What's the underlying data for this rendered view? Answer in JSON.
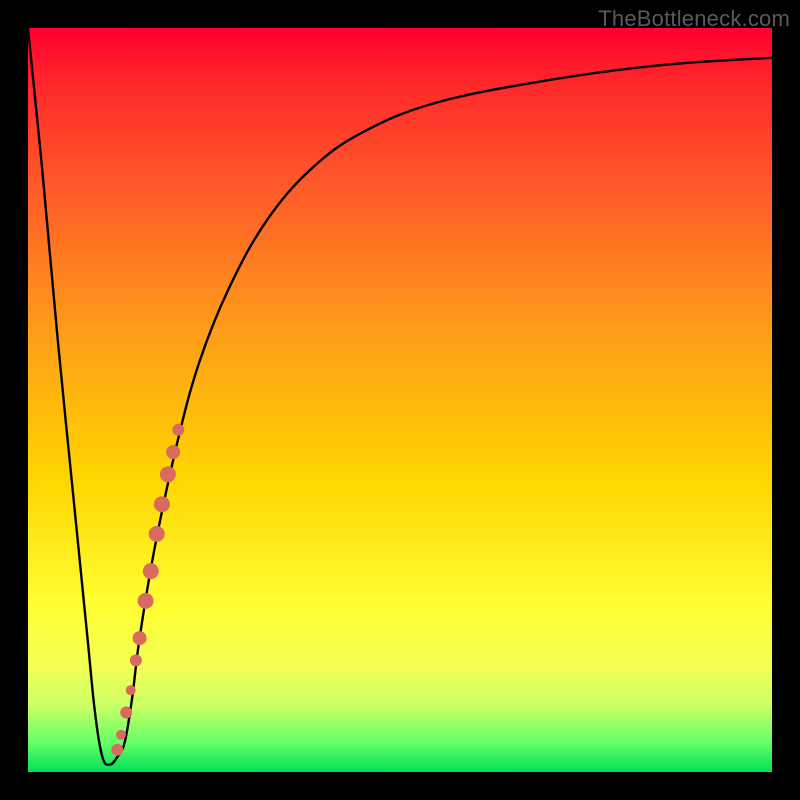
{
  "watermark": "TheBottleneck.com",
  "chart_data": {
    "type": "line",
    "title": "",
    "xlabel": "",
    "ylabel": "",
    "xlim": [
      0,
      100
    ],
    "ylim": [
      0,
      100
    ],
    "grid": false,
    "legend": false,
    "series": [
      {
        "name": "bottleneck-curve",
        "x": [
          0,
          2,
          4,
          6,
          8,
          9,
          10,
          11,
          12,
          13,
          14,
          15,
          17,
          20,
          23,
          27,
          32,
          38,
          45,
          55,
          70,
          85,
          100
        ],
        "y": [
          100,
          80,
          58,
          38,
          18,
          8,
          2,
          1,
          2,
          4,
          10,
          18,
          30,
          44,
          55,
          65,
          74,
          81,
          86,
          90,
          93,
          95,
          96
        ]
      }
    ],
    "marker_band": {
      "name": "highlight-dots",
      "color": "#d86a60",
      "points": [
        {
          "x": 12.0,
          "y": 3,
          "r": 6
        },
        {
          "x": 12.5,
          "y": 5,
          "r": 5
        },
        {
          "x": 13.2,
          "y": 8,
          "r": 6
        },
        {
          "x": 13.8,
          "y": 11,
          "r": 5
        },
        {
          "x": 14.5,
          "y": 15,
          "r": 6
        },
        {
          "x": 15.0,
          "y": 18,
          "r": 7
        },
        {
          "x": 15.8,
          "y": 23,
          "r": 8
        },
        {
          "x": 16.5,
          "y": 27,
          "r": 8
        },
        {
          "x": 17.3,
          "y": 32,
          "r": 8
        },
        {
          "x": 18.0,
          "y": 36,
          "r": 8
        },
        {
          "x": 18.8,
          "y": 40,
          "r": 8
        },
        {
          "x": 19.5,
          "y": 43,
          "r": 7
        },
        {
          "x": 20.2,
          "y": 46,
          "r": 6
        }
      ]
    }
  }
}
